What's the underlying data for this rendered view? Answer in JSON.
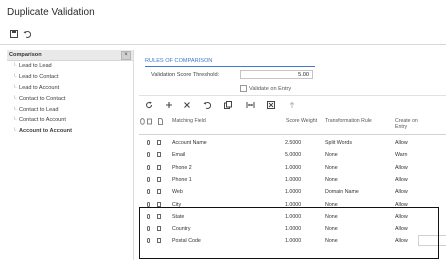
{
  "window": {
    "title": "Duplicate Validation"
  },
  "toolbar": {
    "icons": [
      "save-icon",
      "undo-icon"
    ]
  },
  "comparison_panel": {
    "header": "Comparison",
    "items": [
      {
        "label": "Lead to Lead",
        "selected": false
      },
      {
        "label": "Lead to Contact",
        "selected": false
      },
      {
        "label": "Lead to Account",
        "selected": false
      },
      {
        "label": "Contact to Contact",
        "selected": false
      },
      {
        "label": "Contact to Lead",
        "selected": false
      },
      {
        "label": "Contact to Account",
        "selected": false
      },
      {
        "label": "Account to Account",
        "selected": true
      }
    ]
  },
  "rules": {
    "section_title": "RULES OF COMPARISON",
    "threshold_label": "Validation Score Threshold:",
    "threshold_value": "5.00",
    "validate_on_entry_label": "Validate on Entry",
    "validate_on_entry_checked": false
  },
  "grid_toolbar": {
    "icons": [
      "refresh-icon",
      "add-icon",
      "delete-icon",
      "undo-icon",
      "copy-icon",
      "fit-columns-icon",
      "export-icon",
      "upload-icon"
    ]
  },
  "grid": {
    "columns": [
      "Matching Field",
      "Score Weight",
      "Transformation Rule",
      "Create on Entry"
    ],
    "rows": [
      {
        "field": "Account Name",
        "weight": "2.5000",
        "rule": "Split Words",
        "create": "Allow"
      },
      {
        "field": "Email",
        "weight": "5.0000",
        "rule": "None",
        "create": "Warn"
      },
      {
        "field": "Phone 2",
        "weight": "1.0000",
        "rule": "None",
        "create": "Allow"
      },
      {
        "field": "Phone 1",
        "weight": "1.0000",
        "rule": "None",
        "create": "Allow"
      },
      {
        "field": "Web",
        "weight": "1.0000",
        "rule": "Domain Name",
        "create": "Allow"
      },
      {
        "field": "City",
        "weight": "1.0000",
        "rule": "None",
        "create": "Allow"
      },
      {
        "field": "State",
        "weight": "1.0000",
        "rule": "None",
        "create": "Allow"
      },
      {
        "field": "Country",
        "weight": "1.0000",
        "rule": "None",
        "create": "Allow"
      },
      {
        "field": "Postal Code",
        "weight": "1.0000",
        "rule": "None",
        "create": "Allow"
      }
    ]
  },
  "colors": {
    "accent": "#3f79c9",
    "highlight_border": "#111111"
  }
}
